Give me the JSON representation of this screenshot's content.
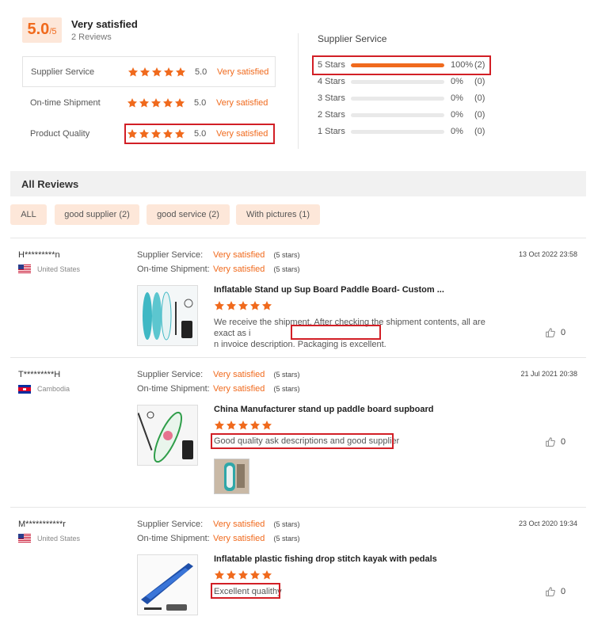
{
  "summary": {
    "score": "5.0",
    "score_max": "/5",
    "title": "Very satisfied",
    "reviews": "2 Reviews"
  },
  "ratings": [
    {
      "label": "Supplier Service",
      "score": "5.0",
      "text": "Very satisfied"
    },
    {
      "label": "On-time Shipment",
      "score": "5.0",
      "text": "Very satisfied"
    },
    {
      "label": "Product Quality",
      "score": "5.0",
      "text": "Very satisfied"
    }
  ],
  "supplier_service": {
    "title": "Supplier Service",
    "bars": [
      {
        "label": "5 Stars",
        "pct": "100%",
        "count": "(2)",
        "fill": 1.0
      },
      {
        "label": "4 Stars",
        "pct": "0%",
        "count": "(0)",
        "fill": 0
      },
      {
        "label": "3 Stars",
        "pct": "0%",
        "count": "(0)",
        "fill": 0
      },
      {
        "label": "2 Stars",
        "pct": "0%",
        "count": "(0)",
        "fill": 0
      },
      {
        "label": "1 Stars",
        "pct": "0%",
        "count": "(0)",
        "fill": 0
      }
    ]
  },
  "all_reviews": {
    "title": "All Reviews",
    "tags": [
      "ALL",
      "good supplier (2)",
      "good service (2)",
      "With pictures (1)"
    ]
  },
  "reviews": [
    {
      "user": "H*********n",
      "country": "United States",
      "date": "13 Oct 2022 23:58",
      "supplier_label": "Supplier Service:",
      "supplier_val": "Very satisfied",
      "supplier_stars": "(5 stars)",
      "shipment_label": "On-time Shipment:",
      "shipment_val": "Very satisfied",
      "shipment_stars": "(5 stars)",
      "product": "Inflatable Stand up Sup Board Paddle Board- Custom ...",
      "text_line1": "We receive the shipment.  After checking the shipment contents, all are exact as i",
      "text_line2": "n invoice description.",
      "text_highlight": "Packaging is excellent.",
      "likes": "0"
    },
    {
      "user": "T*********H",
      "country": "Cambodia",
      "date": "21 Jul 2021 20:38",
      "supplier_label": "Supplier Service:",
      "supplier_val": "Very satisfied",
      "supplier_stars": "(5 stars)",
      "shipment_label": "On-time Shipment:",
      "shipment_val": "Very satisfied",
      "shipment_stars": "(5 stars)",
      "product": "China Manufacturer stand up paddle board supboard",
      "text": "Good quality ask descriptions and good supplier",
      "likes": "0"
    },
    {
      "user": "M***********r",
      "country": "United States",
      "date": "23 Oct 2020 19:34",
      "supplier_label": "Supplier Service:",
      "supplier_val": "Very satisfied",
      "supplier_stars": "(5 stars)",
      "shipment_label": "On-time Shipment:",
      "shipment_val": "Very satisfied",
      "shipment_stars": "(5 stars)",
      "product": "Inflatable plastic fishing drop stitch kayak with pedals",
      "text": "Excellent qualithy",
      "likes": "0"
    }
  ],
  "colors": {
    "accent": "#f06a1d",
    "highlight_box": "#d21f26",
    "tag_bg": "#fde7d9"
  }
}
